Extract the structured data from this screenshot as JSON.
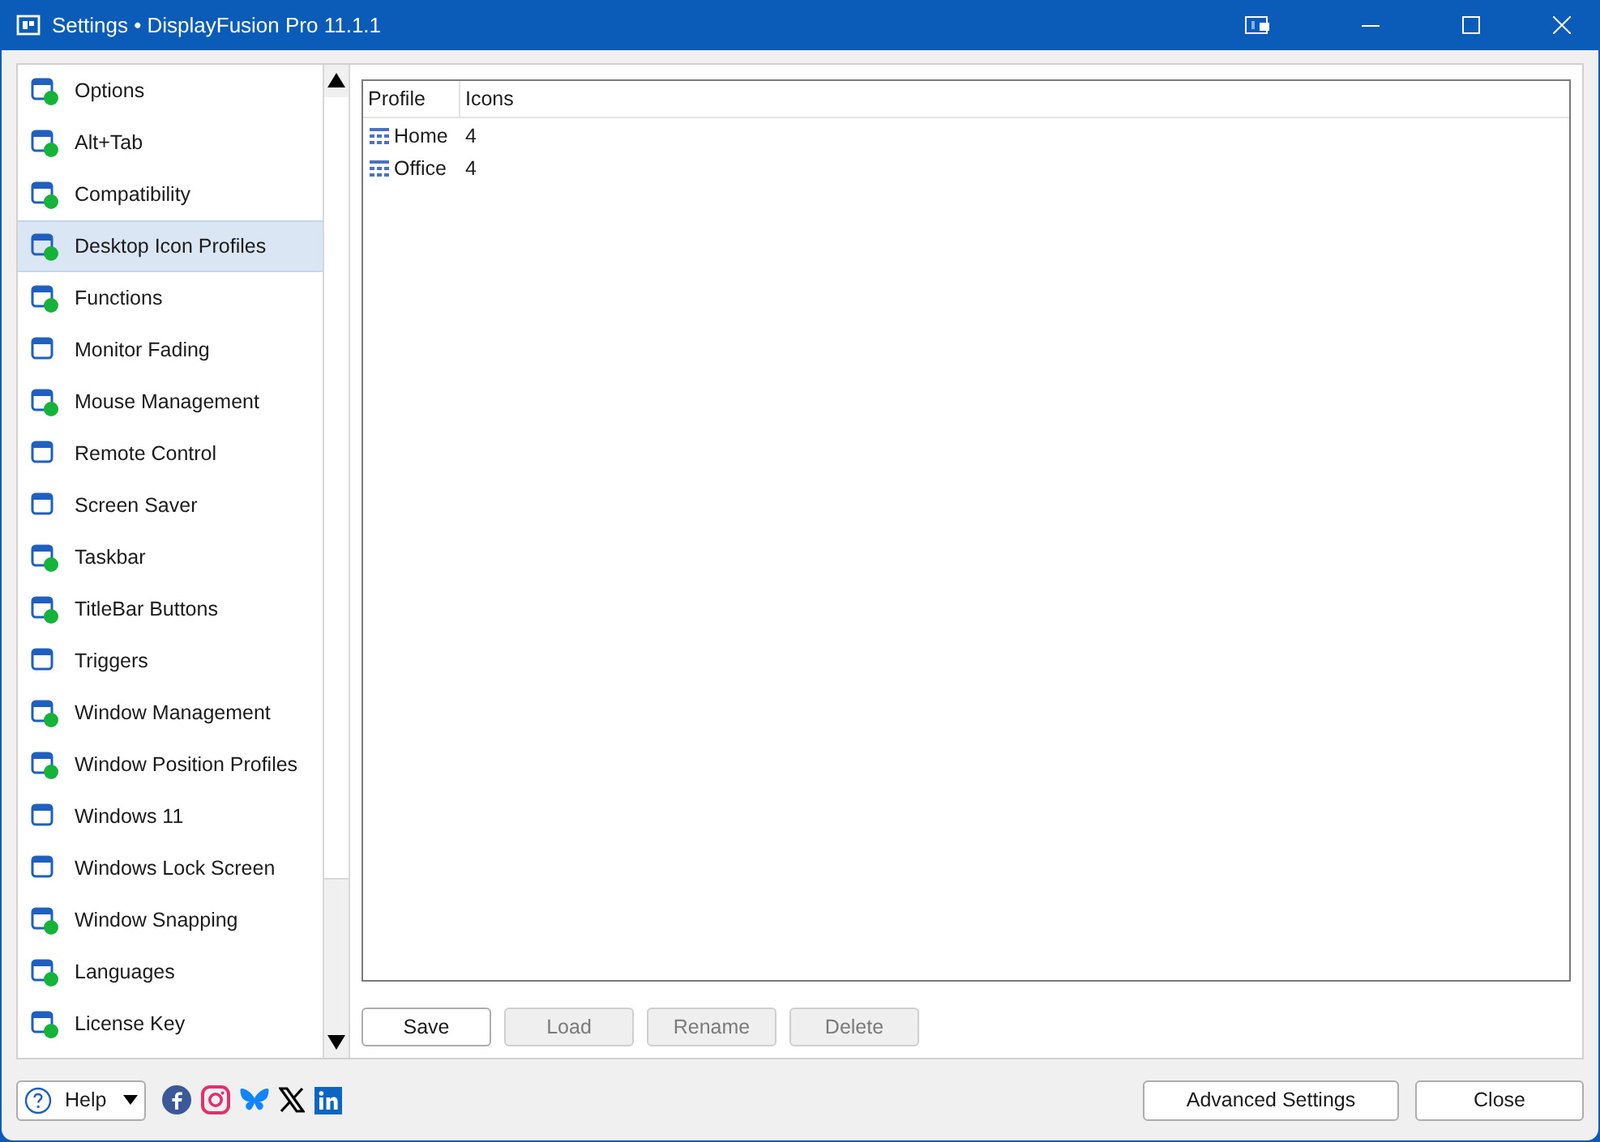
{
  "window": {
    "title": "Settings • DisplayFusion Pro 11.1.1"
  },
  "sidebar": {
    "items": [
      {
        "label": "Options",
        "selected": false,
        "status_dot": true
      },
      {
        "label": "Alt+Tab",
        "selected": false,
        "status_dot": true
      },
      {
        "label": "Compatibility",
        "selected": false,
        "status_dot": true
      },
      {
        "label": "Desktop Icon Profiles",
        "selected": true,
        "status_dot": true
      },
      {
        "label": "Functions",
        "selected": false,
        "status_dot": true
      },
      {
        "label": "Monitor Fading",
        "selected": false,
        "status_dot": false
      },
      {
        "label": "Mouse Management",
        "selected": false,
        "status_dot": true
      },
      {
        "label": "Remote Control",
        "selected": false,
        "status_dot": false
      },
      {
        "label": "Screen Saver",
        "selected": false,
        "status_dot": false
      },
      {
        "label": "Taskbar",
        "selected": false,
        "status_dot": true
      },
      {
        "label": "TitleBar Buttons",
        "selected": false,
        "status_dot": true
      },
      {
        "label": "Triggers",
        "selected": false,
        "status_dot": false
      },
      {
        "label": "Window Management",
        "selected": false,
        "status_dot": true
      },
      {
        "label": "Window Position Profiles",
        "selected": false,
        "status_dot": true
      },
      {
        "label": "Windows 11",
        "selected": false,
        "status_dot": false
      },
      {
        "label": "Windows Lock Screen",
        "selected": false,
        "status_dot": false
      },
      {
        "label": "Window Snapping",
        "selected": false,
        "status_dot": true
      },
      {
        "label": "Languages",
        "selected": false,
        "status_dot": true
      },
      {
        "label": "License Key",
        "selected": false,
        "status_dot": true
      }
    ]
  },
  "table": {
    "columns": [
      "Profile",
      "Icons"
    ],
    "rows": [
      {
        "profile": "Home",
        "icons": "4"
      },
      {
        "profile": "Office",
        "icons": "4"
      }
    ]
  },
  "buttons": [
    {
      "label": "Save",
      "disabled": false
    },
    {
      "label": "Load",
      "disabled": true
    },
    {
      "label": "Rename",
      "disabled": true
    },
    {
      "label": "Delete",
      "disabled": true
    }
  ],
  "footer": {
    "help": "Help",
    "advanced": "Advanced Settings",
    "close": "Close"
  }
}
